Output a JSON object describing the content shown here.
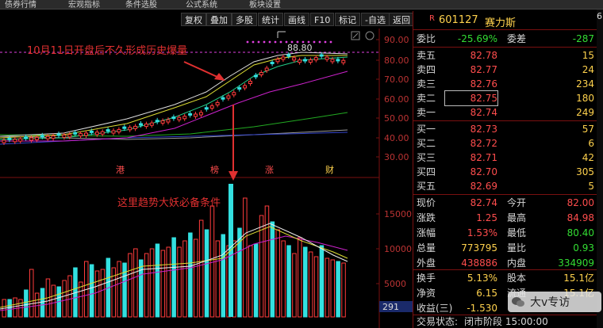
{
  "menu": [
    "债券行情",
    "宏观指标",
    "条件选股",
    "公式系统",
    "板块设置"
  ],
  "toolbar": [
    "复权",
    "叠加",
    "多股",
    "统计",
    "画线",
    "F10",
    "标记",
    "-自选",
    "返回"
  ],
  "annotations": {
    "top": "10月11日开盘后不久形成历史爆量",
    "bottom": "这里趋势大妖必备条件",
    "peak_price": "88.80",
    "badges": [
      "港",
      "榜",
      "涨",
      "财"
    ]
  },
  "axis": {
    "price_ticks": [
      "90.00",
      "80.00",
      "70.00",
      "60.00",
      "50.00",
      "40.00",
      "30.00"
    ],
    "volume_ticks": [
      "15000",
      "10000",
      "5000"
    ],
    "volume_readout": "291",
    "right_edge": "6"
  },
  "quote": {
    "badge": "R",
    "code": "601127",
    "name": "赛力斯",
    "weibi_label": "委比",
    "weibi": "-25.69%",
    "weicha_label": "委差",
    "weicha": "-287",
    "asks": [
      {
        "label": "卖五",
        "price": "82.78",
        "vol": "15"
      },
      {
        "label": "卖四",
        "price": "82.77",
        "vol": "24"
      },
      {
        "label": "卖三",
        "price": "82.76",
        "vol": "234"
      },
      {
        "label": "卖二",
        "price": "82.75",
        "vol": "180"
      },
      {
        "label": "卖一",
        "price": "82.74",
        "vol": "249"
      }
    ],
    "bids": [
      {
        "label": "买一",
        "price": "82.73",
        "vol": "57"
      },
      {
        "label": "买二",
        "price": "82.72",
        "vol": "6"
      },
      {
        "label": "买三",
        "price": "82.71",
        "vol": "42"
      },
      {
        "label": "买四",
        "price": "82.70",
        "vol": "305"
      },
      {
        "label": "买五",
        "price": "82.69",
        "vol": "5"
      }
    ],
    "stats": [
      {
        "l1": "现价",
        "v1": "82.74",
        "c1": "#ff4d4d",
        "l2": "今开",
        "v2": "82.00",
        "c2": "#ff4d4d"
      },
      {
        "l1": "涨跌",
        "v1": "1.25",
        "c1": "#ff4d4d",
        "l2": "最高",
        "v2": "84.98",
        "c2": "#ff4d4d"
      },
      {
        "l1": "涨幅",
        "v1": "1.53%",
        "c1": "#ff4d4d",
        "l2": "最低",
        "v2": "80.40",
        "c2": "#33dd33"
      },
      {
        "l1": "总量",
        "v1": "773795",
        "c1": "#ffd24d",
        "l2": "量比",
        "v2": "0.93",
        "c2": "#33dd33"
      },
      {
        "l1": "外盘",
        "v1": "438886",
        "c1": "#ff4d4d",
        "l2": "内盘",
        "v2": "334909",
        "c2": "#33dd33"
      }
    ],
    "stats2": [
      {
        "l1": "换手",
        "v1": "5.13%",
        "c1": "#ffd24d",
        "l2": "股本",
        "v2": "15.1亿",
        "c2": "#ffd24d"
      },
      {
        "l1": "净资",
        "v1": "6.15",
        "c1": "#ffd24d",
        "l2": "流通",
        "v2": "15.1亿",
        "c2": "#ffd24d"
      },
      {
        "l1": "收益(三)",
        "v1": "-1.530",
        "c1": "#ffd24d",
        "l2": "",
        "v2": "",
        "c2": "#ffd24d"
      }
    ],
    "trade_status_label": "交易状态:",
    "trade_status": "闭市阶段 15:00:00"
  },
  "watermark": "大v专访"
}
